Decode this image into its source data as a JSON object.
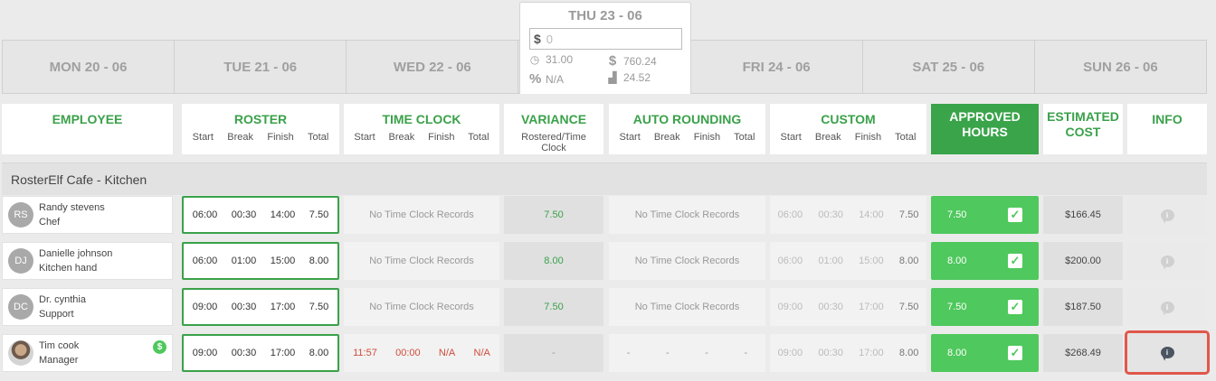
{
  "days": [
    "MON 20 - 06",
    "TUE 21 - 06",
    "WED 22 - 06",
    "THU 23 - 06",
    "FRI 24 - 06",
    "SAT 25 - 06",
    "SUN 26 - 06"
  ],
  "popup": {
    "title": "THU 23 - 06",
    "currency_symbol": "$",
    "input_placeholder": "0",
    "hours": "31.00",
    "cost": "760.24",
    "percent": "N/A",
    "chart_value": "24.52"
  },
  "headers": {
    "employee": "EMPLOYEE",
    "roster": "ROSTER",
    "time_clock": "TIME CLOCK",
    "variance": "VARIANCE",
    "variance_sub": "Rostered/Time Clock",
    "auto_rounding": "AUTO ROUNDING",
    "custom": "CUSTOM",
    "approved_line1": "APPROVED",
    "approved_line2": "HOURS",
    "estimated_line1": "ESTIMATED",
    "estimated_line2": "COST",
    "info": "INFO",
    "sub": [
      "Start",
      "Break",
      "Finish",
      "Total"
    ]
  },
  "group": "RosterElf Cafe - Kitchen",
  "no_records": "No Time Clock Records",
  "rows": [
    {
      "initials": "RS",
      "name": "Randy stevens",
      "role": "Chef",
      "roster": [
        "06:00",
        "00:30",
        "14:00",
        "7.50"
      ],
      "time_clock": null,
      "variance": "7.50",
      "auto": null,
      "custom": [
        "06:00",
        "00:30",
        "14:00",
        "7.50"
      ],
      "approved": "7.50",
      "cost": "$166.45"
    },
    {
      "initials": "DJ",
      "name": "Danielle johnson",
      "role": "Kitchen hand",
      "roster": [
        "06:00",
        "01:00",
        "15:00",
        "8.00"
      ],
      "time_clock": null,
      "variance": "8.00",
      "auto": null,
      "custom": [
        "06:00",
        "01:00",
        "15:00",
        "8.00"
      ],
      "approved": "8.00",
      "cost": "$200.00"
    },
    {
      "initials": "DC",
      "name": "Dr. cynthia",
      "role": "Support",
      "roster": [
        "09:00",
        "00:30",
        "17:00",
        "7.50"
      ],
      "time_clock": null,
      "variance": "7.50",
      "auto": null,
      "custom": [
        "09:00",
        "00:30",
        "17:00",
        "7.50"
      ],
      "approved": "7.50",
      "cost": "$187.50"
    },
    {
      "initials": "",
      "name": "Tim cook",
      "role": "Manager",
      "roster": [
        "09:00",
        "00:30",
        "17:00",
        "8.00"
      ],
      "time_clock": [
        "11:57",
        "00:00",
        "N/A",
        "N/A"
      ],
      "variance": "-",
      "auto": [
        "-",
        "-",
        "-",
        "-"
      ],
      "custom": [
        "09:00",
        "00:30",
        "17:00",
        "8.00"
      ],
      "approved": "8.00",
      "cost": "$268.49"
    }
  ],
  "icons": {
    "check": "check-icon",
    "info": "comment-info-icon",
    "clock": "clock-icon",
    "dollar": "dollar-icon",
    "percent": "percent-icon",
    "chart": "chart-icon"
  },
  "colors": {
    "accent_green": "#3aa14a",
    "approved_green": "#4fc85d",
    "highlight_red": "#e0574a",
    "time_clock_red": "#cf4b3b"
  }
}
